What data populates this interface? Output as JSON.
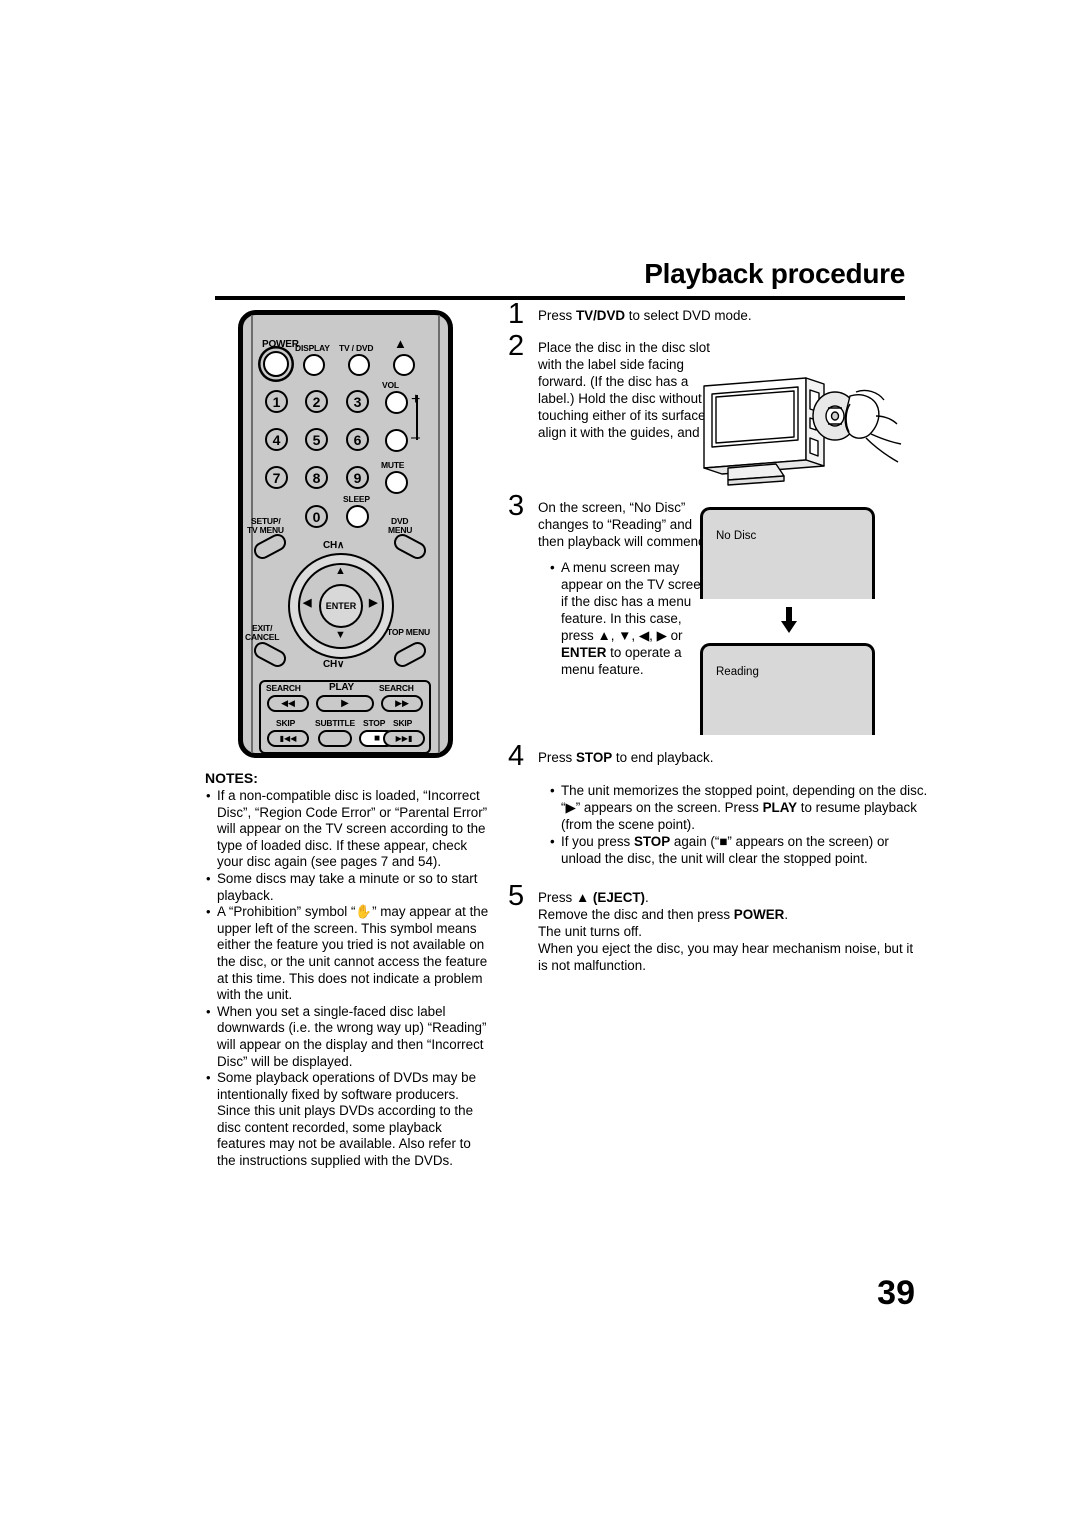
{
  "page": {
    "title": "Playback procedure",
    "number": "39"
  },
  "remote": {
    "name": "tv-dvd-remote-control",
    "buttons": {
      "power": "POWER",
      "display": "DISPLAY",
      "tv_dvd": "TV / DVD",
      "eject": "▲",
      "vol": "VOL",
      "vol_plus": "+",
      "vol_minus": "–",
      "mute": "MUTE",
      "sleep": "SLEEP",
      "setup_tv_menu_line1": "SETUP/",
      "setup_tv_menu_line2": "TV MENU",
      "dvd_menu_line1": "DVD",
      "dvd_menu_line2": "MENU",
      "ch_up": "CH∧",
      "ch_down": "CH∨",
      "enter": "ENTER",
      "exit_cancel_line1": "EXIT/",
      "exit_cancel_line2": "CANCEL",
      "top_menu": "TOP MENU",
      "search_rev": "SEARCH",
      "play": "PLAY",
      "search_fwd": "SEARCH",
      "skip_back": "SKIP",
      "subtitle": "SUBTITLE",
      "stop": "STOP",
      "skip_fwd": "SKIP",
      "numbers": [
        "1",
        "2",
        "3",
        "4",
        "5",
        "6",
        "7",
        "8",
        "9",
        "0"
      ]
    }
  },
  "notes": {
    "heading": "NOTES:",
    "items": [
      "If a non-compatible disc is loaded, “Incorrect Disc”, “Region Code Error” or “Parental Error” will appear on the TV screen according to the type of loaded disc. If these appear, check your disc again (see pages 7 and 54).",
      "Some discs may take a minute or so to start playback.",
      "A “Prohibition” symbol “✋” may appear at the upper left of the screen. This symbol means either the feature you tried is not available on the disc, or the unit cannot access the feature at this time. This does not indicate a problem with the unit.",
      "When you set a single-faced disc label downwards (i.e. the wrong way up) “Reading” will appear on the display and then “Incorrect Disc” will be displayed.",
      "Some playback operations of DVDs may be intentionally fixed by software producers. Since this unit plays DVDs according to the disc content recorded, some playback features may not be available. Also refer to the instructions supplied with the DVDs."
    ]
  },
  "steps": [
    {
      "num": "1",
      "text_parts": [
        {
          "t": "Press ",
          "b": false
        },
        {
          "t": "TV/DVD",
          "b": true
        },
        {
          "t": " to select DVD mode.",
          "b": false
        }
      ]
    },
    {
      "num": "2",
      "narrow_text": "Place the disc in the disc slot with the label side facing forward. (If the disc has a label.) Hold the disc without touching either of its surfaces,",
      "wide_text": "align it with the guides, and place it in position."
    },
    {
      "num": "3",
      "narrow_text": "On the screen, “No Disc” changes to “Reading” and then playback will commence.",
      "bullet_parts": [
        {
          "t": "A menu screen may appear on the TV screen, if the disc has a menu feature. In this case, press ▲, ▼, ◀, ▶ or ",
          "b": false
        },
        {
          "t": "ENTER",
          "b": true
        },
        {
          "t": " to operate a menu feature.",
          "b": false
        }
      ]
    },
    {
      "num": "4",
      "text_parts": [
        {
          "t": "Press ",
          "b": false
        },
        {
          "t": "STOP",
          "b": true
        },
        {
          "t": " to end playback.",
          "b": false
        }
      ],
      "bullets": [
        [
          {
            "t": "The unit memorizes the stopped point, depending on the disc. “▶” appears on the screen. Press ",
            "b": false
          },
          {
            "t": "PLAY",
            "b": true
          },
          {
            "t": " to resume playback (from the scene point).",
            "b": false
          }
        ],
        [
          {
            "t": "If you press ",
            "b": false
          },
          {
            "t": "STOP",
            "b": true
          },
          {
            "t": " again (“■” appears on the screen) or unload the disc, the unit will clear the stopped point.",
            "b": false
          }
        ]
      ]
    },
    {
      "num": "5",
      "lines": [
        [
          {
            "t": "Press ",
            "b": false
          },
          {
            "t": "▲ (EJECT)",
            "b": true
          },
          {
            "t": ".",
            "b": false
          }
        ],
        [
          {
            "t": "Remove the disc and then press ",
            "b": false
          },
          {
            "t": "POWER",
            "b": true
          },
          {
            "t": ".",
            "b": false
          }
        ],
        [
          {
            "t": "The unit turns off.",
            "b": false
          }
        ],
        [
          {
            "t": "When you eject the disc, you may hear mechanism noise, but it is not malfunction.",
            "b": false
          }
        ]
      ]
    }
  ],
  "tv_screens": {
    "screen1_text": "No Disc",
    "screen2_text": "Reading"
  },
  "colors": {
    "remote_body": "#c9c9c9",
    "screen_fill": "#d8d8d8",
    "ink": "#000000",
    "paper": "#ffffff"
  }
}
